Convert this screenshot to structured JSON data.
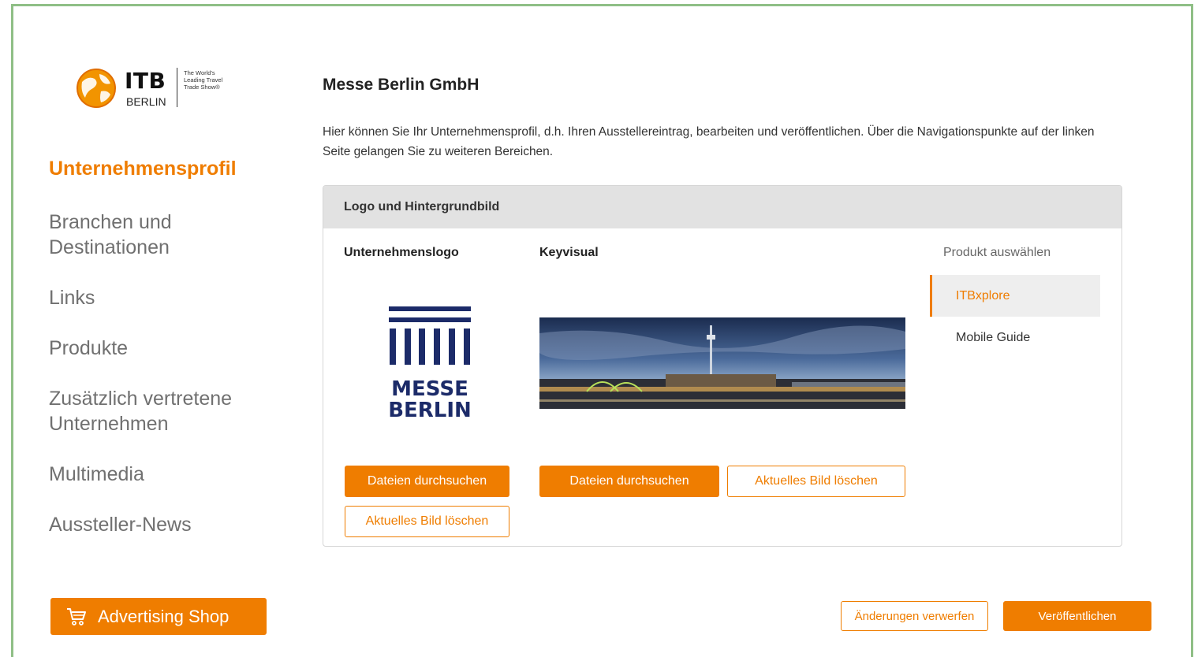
{
  "brand": {
    "name": "ITB",
    "city": "BERLIN",
    "tagline": "The World's Leading Travel Trade Show®"
  },
  "sidebar": {
    "items": [
      {
        "label": "Unternehmensprofil",
        "active": true
      },
      {
        "label": "Branchen und Destinationen",
        "active": false
      },
      {
        "label": "Links",
        "active": false
      },
      {
        "label": "Produkte",
        "active": false
      },
      {
        "label": "Zusätzlich vertretene Unternehmen",
        "active": false
      },
      {
        "label": "Multimedia",
        "active": false
      },
      {
        "label": "Aussteller-News",
        "active": false
      }
    ],
    "shop_label": "Advertising Shop",
    "shop_icon": "cart-icon"
  },
  "main": {
    "company_name": "Messe Berlin GmbH",
    "intro": "Hier können Sie Ihr Unternehmensprofil, d.h. Ihren Ausstellereintrag, bearbeiten und veröffentlichen. Über die Navigationspunkte auf der linken Seite gelangen Sie zu weiteren Bereichen.",
    "panel": {
      "title": "Logo und Hintergrundbild",
      "logo_col": {
        "title": "Unternehmenslogo",
        "logo_text_1": "MESSE",
        "logo_text_2": "BERLIN",
        "browse_label": "Dateien durchsuchen",
        "delete_label": "Aktuelles Bild löschen"
      },
      "keyvisual_col": {
        "title": "Keyvisual",
        "browse_label": "Dateien durchsuchen",
        "delete_label": "Aktuelles Bild löschen"
      },
      "product": {
        "label": "Produkt auswählen",
        "options": [
          {
            "label": "ITBxplore",
            "selected": true
          },
          {
            "label": "Mobile Guide",
            "selected": false
          }
        ]
      }
    }
  },
  "footer": {
    "discard_label": "Änderungen verwerfen",
    "publish_label": "Veröffentlichen"
  },
  "colors": {
    "accent": "#ef7d00",
    "frame": "#8fbf86",
    "logo_blue": "#1c2b69"
  }
}
